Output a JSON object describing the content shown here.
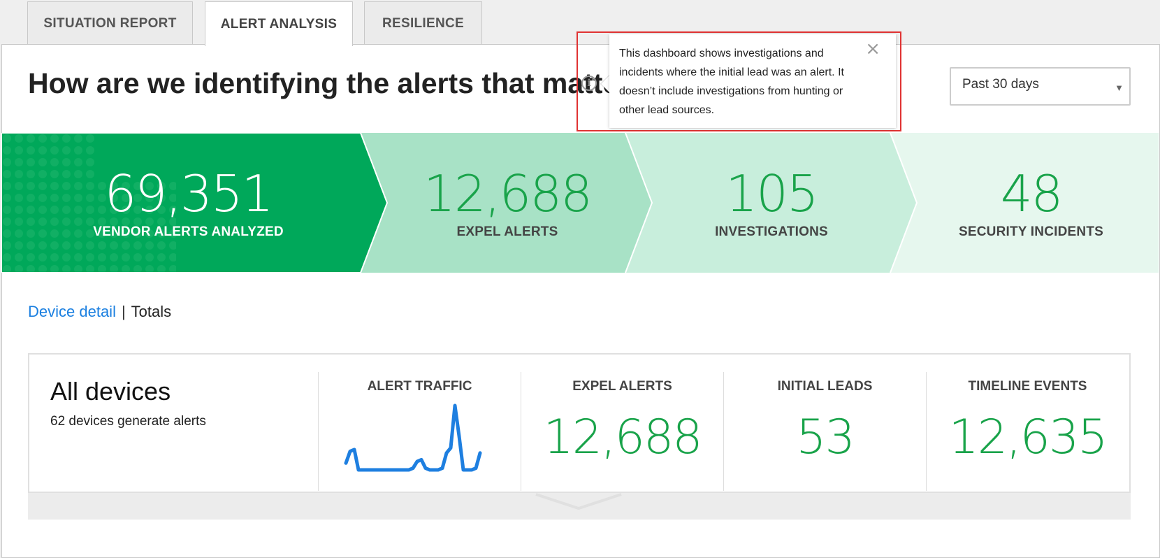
{
  "tabs": [
    {
      "label": "SITUATION REPORT",
      "active": false
    },
    {
      "label": "ALERT ANALYSIS",
      "active": true
    },
    {
      "label": "RESILIENCE",
      "active": false
    }
  ],
  "header": {
    "title": "How are we identifying the alerts that matter?",
    "info_icon": "info-icon"
  },
  "tooltip": {
    "text": "This dashboard shows investigations and incidents where the initial lead was an alert. It doesn’t include investigations from hunting or other lead sources.",
    "close_icon": "×"
  },
  "date_filter": {
    "selected": "Past 30 days",
    "caret": "▼"
  },
  "funnel": {
    "stages": [
      {
        "value": "69,351",
        "label": "VENDOR ALERTS ANALYZED"
      },
      {
        "value": "12,688",
        "label": "EXPEL ALERTS"
      },
      {
        "value": "105",
        "label": "INVESTIGATIONS"
      },
      {
        "value": "48",
        "label": "SECURITY INCIDENTS"
      }
    ],
    "colors": {
      "stage1": "#00a85a",
      "stage2": "#a8e2c6",
      "stage3": "#c8eedc",
      "stage4": "#e6f7ee",
      "stage1_text": "#ffffff",
      "number_green": "#19a34a",
      "label_gray": "#444444"
    }
  },
  "view_toggle": {
    "device_detail": "Device detail",
    "separator": "|",
    "totals": "Totals"
  },
  "devices_card": {
    "title": "All devices",
    "subtitle": "62 devices generate alerts",
    "alert_traffic_label": "ALERT TRAFFIC",
    "alert_traffic_color": "#1e7fe0",
    "alert_traffic_series": [
      4,
      11,
      12,
      0,
      0,
      0,
      0,
      0,
      0,
      0,
      0,
      0,
      0,
      0,
      0,
      0,
      1,
      5,
      6,
      1,
      0,
      0,
      0,
      1,
      10,
      13,
      38,
      20,
      0,
      0,
      0,
      1,
      10
    ],
    "metrics": [
      {
        "label": "EXPEL ALERTS",
        "value": "12,688"
      },
      {
        "label": "INITIAL LEADS",
        "value": "53"
      },
      {
        "label": "TIMELINE EVENTS",
        "value": "12,635"
      }
    ]
  }
}
